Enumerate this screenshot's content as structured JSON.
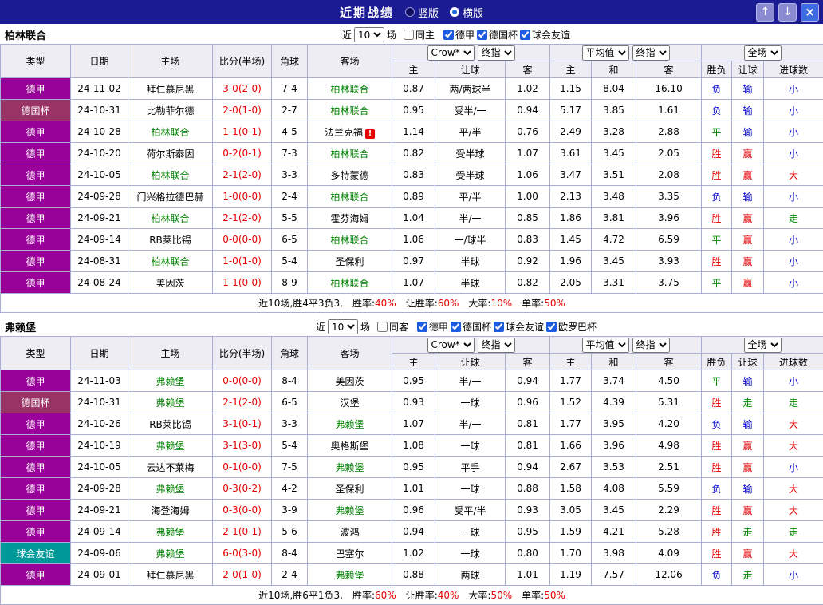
{
  "titlebar": {
    "title": "近期战绩",
    "radios": [
      {
        "label": "竖版",
        "selected": false
      },
      {
        "label": "横版",
        "selected": true
      }
    ],
    "up_icon": "↑",
    "down_icon": "↓",
    "close_icon": "×"
  },
  "filter_labels": {
    "prefix": "近",
    "suffix": "场",
    "count_options": [
      "10"
    ]
  },
  "table_header": {
    "fixed_columns": [
      "类型",
      "日期",
      "主场",
      "比分(半场)",
      "角球",
      "客场"
    ],
    "odds_columns": [
      "主",
      "让球",
      "客"
    ],
    "avg_columns": [
      "主",
      "和",
      "客"
    ],
    "result_columns": [
      "胜负",
      "让球",
      "进球数"
    ],
    "odds_company_options": [
      "Crow*"
    ],
    "odds_type_options": [
      "终指"
    ],
    "avg_source_options": [
      "平均值"
    ],
    "avg_type_options": [
      "终指"
    ],
    "scope_options": [
      "全场"
    ]
  },
  "colors": {
    "navy": "#1b1b93",
    "type_colors": {
      "德甲": "#990099",
      "德国杯": "#993366",
      "球会友谊": "#009999"
    },
    "outcome_colors": {
      "win": "#e60000",
      "draw": "#008800",
      "loss": "#0000cc"
    },
    "focus_team": "#008000",
    "score": "#e60000",
    "summary_value": "#e60000"
  },
  "outcome_map": {
    "胜": "win",
    "赢": "win",
    "大": "win",
    "平": "draw",
    "走": "draw",
    "负": "loss",
    "输": "loss",
    "小": "loss"
  },
  "sections": [
    {
      "team": "柏林联合",
      "filter": {
        "count": "10",
        "same_label": "同主",
        "same_checked": false,
        "leagues": [
          {
            "label": "德甲",
            "checked": true
          },
          {
            "label": "德国杯",
            "checked": true
          },
          {
            "label": "球会友谊",
            "checked": true
          }
        ]
      },
      "rows": [
        {
          "type": "德甲",
          "date": "24-11-02",
          "home": "拜仁慕尼黑",
          "home_focus": false,
          "score": "3-0(2-0)",
          "corner": "7-4",
          "away": "柏林联合",
          "away_focus": true,
          "alert": false,
          "odds": [
            "0.87",
            "两/两球半",
            "1.02"
          ],
          "avg": [
            "1.15",
            "8.04",
            "16.10"
          ],
          "results": [
            "负",
            "输",
            "小"
          ]
        },
        {
          "type": "德国杯",
          "date": "24-10-31",
          "home": "比勒菲尔德",
          "home_focus": false,
          "score": "2-0(1-0)",
          "corner": "2-7",
          "away": "柏林联合",
          "away_focus": true,
          "alert": false,
          "odds": [
            "0.95",
            "受半/一",
            "0.94"
          ],
          "avg": [
            "5.17",
            "3.85",
            "1.61"
          ],
          "results": [
            "负",
            "输",
            "小"
          ]
        },
        {
          "type": "德甲",
          "date": "24-10-28",
          "home": "柏林联合",
          "home_focus": true,
          "score": "1-1(0-1)",
          "corner": "4-5",
          "away": "法兰克福",
          "away_focus": false,
          "alert": true,
          "odds": [
            "1.14",
            "平/半",
            "0.76"
          ],
          "avg": [
            "2.49",
            "3.28",
            "2.88"
          ],
          "results": [
            "平",
            "输",
            "小"
          ]
        },
        {
          "type": "德甲",
          "date": "24-10-20",
          "home": "荷尔斯泰因",
          "home_focus": false,
          "score": "0-2(0-1)",
          "corner": "7-3",
          "away": "柏林联合",
          "away_focus": true,
          "alert": false,
          "odds": [
            "0.82",
            "受半球",
            "1.07"
          ],
          "avg": [
            "3.61",
            "3.45",
            "2.05"
          ],
          "results": [
            "胜",
            "赢",
            "小"
          ]
        },
        {
          "type": "德甲",
          "date": "24-10-05",
          "home": "柏林联合",
          "home_focus": true,
          "score": "2-1(2-0)",
          "corner": "3-3",
          "away": "多特蒙德",
          "away_focus": false,
          "alert": false,
          "odds": [
            "0.83",
            "受半球",
            "1.06"
          ],
          "avg": [
            "3.47",
            "3.51",
            "2.08"
          ],
          "results": [
            "胜",
            "赢",
            "大"
          ]
        },
        {
          "type": "德甲",
          "date": "24-09-28",
          "home": "门兴格拉德巴赫",
          "home_focus": false,
          "score": "1-0(0-0)",
          "corner": "2-4",
          "away": "柏林联合",
          "away_focus": true,
          "alert": false,
          "odds": [
            "0.89",
            "平/半",
            "1.00"
          ],
          "avg": [
            "2.13",
            "3.48",
            "3.35"
          ],
          "results": [
            "负",
            "输",
            "小"
          ]
        },
        {
          "type": "德甲",
          "date": "24-09-21",
          "home": "柏林联合",
          "home_focus": true,
          "score": "2-1(2-0)",
          "corner": "5-5",
          "away": "霍芬海姆",
          "away_focus": false,
          "alert": false,
          "odds": [
            "1.04",
            "半/一",
            "0.85"
          ],
          "avg": [
            "1.86",
            "3.81",
            "3.96"
          ],
          "results": [
            "胜",
            "赢",
            "走"
          ]
        },
        {
          "type": "德甲",
          "date": "24-09-14",
          "home": "RB莱比锡",
          "home_focus": false,
          "score": "0-0(0-0)",
          "corner": "6-5",
          "away": "柏林联合",
          "away_focus": true,
          "alert": false,
          "odds": [
            "1.06",
            "一/球半",
            "0.83"
          ],
          "avg": [
            "1.45",
            "4.72",
            "6.59"
          ],
          "results": [
            "平",
            "赢",
            "小"
          ]
        },
        {
          "type": "德甲",
          "date": "24-08-31",
          "home": "柏林联合",
          "home_focus": true,
          "score": "1-0(1-0)",
          "corner": "5-4",
          "away": "圣保利",
          "away_focus": false,
          "alert": false,
          "odds": [
            "0.97",
            "半球",
            "0.92"
          ],
          "avg": [
            "1.96",
            "3.45",
            "3.93"
          ],
          "results": [
            "胜",
            "赢",
            "小"
          ]
        },
        {
          "type": "德甲",
          "date": "24-08-24",
          "home": "美因茨",
          "home_focus": false,
          "score": "1-1(0-0)",
          "corner": "8-9",
          "away": "柏林联合",
          "away_focus": true,
          "alert": false,
          "odds": [
            "1.07",
            "半球",
            "0.82"
          ],
          "avg": [
            "2.05",
            "3.31",
            "3.75"
          ],
          "results": [
            "平",
            "赢",
            "小"
          ]
        }
      ],
      "summary": {
        "intro": "近10场,胜4平3负3,",
        "stats": [
          [
            "胜率:",
            "40%"
          ],
          [
            "让胜率:",
            "60%"
          ],
          [
            "大率:",
            "10%"
          ],
          [
            "单率:",
            "50%"
          ]
        ]
      }
    },
    {
      "team": "弗赖堡",
      "filter": {
        "count": "10",
        "same_label": "同客",
        "same_checked": false,
        "leagues": [
          {
            "label": "德甲",
            "checked": true
          },
          {
            "label": "德国杯",
            "checked": true
          },
          {
            "label": "球会友谊",
            "checked": true
          },
          {
            "label": "欧罗巴杯",
            "checked": true
          }
        ]
      },
      "rows": [
        {
          "type": "德甲",
          "date": "24-11-03",
          "home": "弗赖堡",
          "home_focus": true,
          "score": "0-0(0-0)",
          "corner": "8-4",
          "away": "美因茨",
          "away_focus": false,
          "alert": false,
          "odds": [
            "0.95",
            "半/一",
            "0.94"
          ],
          "avg": [
            "1.77",
            "3.74",
            "4.50"
          ],
          "results": [
            "平",
            "输",
            "小"
          ]
        },
        {
          "type": "德国杯",
          "date": "24-10-31",
          "home": "弗赖堡",
          "home_focus": true,
          "score": "2-1(2-0)",
          "corner": "6-5",
          "away": "汉堡",
          "away_focus": false,
          "alert": false,
          "odds": [
            "0.93",
            "一球",
            "0.96"
          ],
          "avg": [
            "1.52",
            "4.39",
            "5.31"
          ],
          "results": [
            "胜",
            "走",
            "走"
          ]
        },
        {
          "type": "德甲",
          "date": "24-10-26",
          "home": "RB莱比锡",
          "home_focus": false,
          "score": "3-1(0-1)",
          "corner": "3-3",
          "away": "弗赖堡",
          "away_focus": true,
          "alert": false,
          "odds": [
            "1.07",
            "半/一",
            "0.81"
          ],
          "avg": [
            "1.77",
            "3.95",
            "4.20"
          ],
          "results": [
            "负",
            "输",
            "大"
          ]
        },
        {
          "type": "德甲",
          "date": "24-10-19",
          "home": "弗赖堡",
          "home_focus": true,
          "score": "3-1(3-0)",
          "corner": "5-4",
          "away": "奥格斯堡",
          "away_focus": false,
          "alert": false,
          "odds": [
            "1.08",
            "一球",
            "0.81"
          ],
          "avg": [
            "1.66",
            "3.96",
            "4.98"
          ],
          "results": [
            "胜",
            "赢",
            "大"
          ]
        },
        {
          "type": "德甲",
          "date": "24-10-05",
          "home": "云达不莱梅",
          "home_focus": false,
          "score": "0-1(0-0)",
          "corner": "7-5",
          "away": "弗赖堡",
          "away_focus": true,
          "alert": false,
          "odds": [
            "0.95",
            "平手",
            "0.94"
          ],
          "avg": [
            "2.67",
            "3.53",
            "2.51"
          ],
          "results": [
            "胜",
            "赢",
            "小"
          ]
        },
        {
          "type": "德甲",
          "date": "24-09-28",
          "home": "弗赖堡",
          "home_focus": true,
          "score": "0-3(0-2)",
          "corner": "4-2",
          "away": "圣保利",
          "away_focus": false,
          "alert": false,
          "odds": [
            "1.01",
            "一球",
            "0.88"
          ],
          "avg": [
            "1.58",
            "4.08",
            "5.59"
          ],
          "results": [
            "负",
            "输",
            "大"
          ]
        },
        {
          "type": "德甲",
          "date": "24-09-21",
          "home": "海登海姆",
          "home_focus": false,
          "score": "0-3(0-0)",
          "corner": "3-9",
          "away": "弗赖堡",
          "away_focus": true,
          "alert": false,
          "odds": [
            "0.96",
            "受平/半",
            "0.93"
          ],
          "avg": [
            "3.05",
            "3.45",
            "2.29"
          ],
          "results": [
            "胜",
            "赢",
            "大"
          ]
        },
        {
          "type": "德甲",
          "date": "24-09-14",
          "home": "弗赖堡",
          "home_focus": true,
          "score": "2-1(0-1)",
          "corner": "5-6",
          "away": "波鸿",
          "away_focus": false,
          "alert": false,
          "odds": [
            "0.94",
            "一球",
            "0.95"
          ],
          "avg": [
            "1.59",
            "4.21",
            "5.28"
          ],
          "results": [
            "胜",
            "走",
            "走"
          ]
        },
        {
          "type": "球会友谊",
          "date": "24-09-06",
          "home": "弗赖堡",
          "home_focus": true,
          "score": "6-0(3-0)",
          "corner": "8-4",
          "away": "巴塞尔",
          "away_focus": false,
          "alert": false,
          "odds": [
            "1.02",
            "一球",
            "0.80"
          ],
          "avg": [
            "1.70",
            "3.98",
            "4.09"
          ],
          "results": [
            "胜",
            "赢",
            "大"
          ]
        },
        {
          "type": "德甲",
          "date": "24-09-01",
          "home": "拜仁慕尼黑",
          "home_focus": false,
          "score": "2-0(1-0)",
          "corner": "2-4",
          "away": "弗赖堡",
          "away_focus": true,
          "alert": false,
          "odds": [
            "0.88",
            "两球",
            "1.01"
          ],
          "avg": [
            "1.19",
            "7.57",
            "12.06"
          ],
          "results": [
            "负",
            "走",
            "小"
          ]
        }
      ],
      "summary": {
        "intro": "近10场,胜6平1负3,",
        "stats": [
          [
            "胜率:",
            "60%"
          ],
          [
            "让胜率:",
            "40%"
          ],
          [
            "大率:",
            "50%"
          ],
          [
            "单率:",
            "50%"
          ]
        ]
      }
    }
  ]
}
